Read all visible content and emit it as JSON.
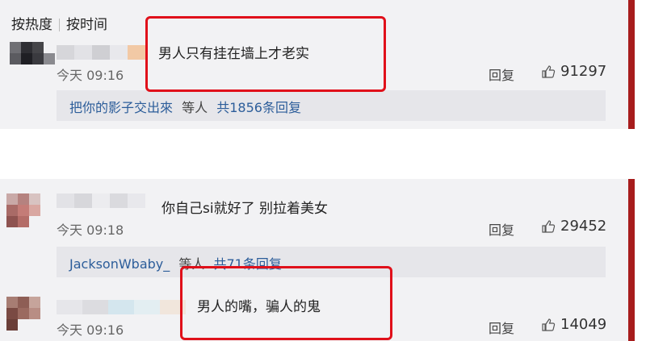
{
  "sort": {
    "hot_label": "按热度",
    "time_label": "按时间"
  },
  "comments": [
    {
      "text": "男人只有挂在墙上才老实",
      "time": "今天 09:16",
      "reply_label": "回复",
      "likes": "91297",
      "thread": {
        "users": "把你的影子交出來",
        "suffix": "等人",
        "count": "共1856条回复"
      }
    },
    {
      "text": "你自己si就好了 别拉着美女",
      "time": "今天 09:18",
      "reply_label": "回复",
      "likes": "29452",
      "thread": {
        "users": "JacksonWbaby_",
        "suffix": "等人",
        "count": "共71条回复"
      }
    },
    {
      "text": "男人的嘴，骗人的鬼",
      "time": "今天 09:16",
      "reply_label": "回复",
      "likes": "14049"
    }
  ],
  "colors": {
    "highlight": "#e0101a",
    "accent_bar": "#a71c1c",
    "link": "#2c5d9a"
  }
}
